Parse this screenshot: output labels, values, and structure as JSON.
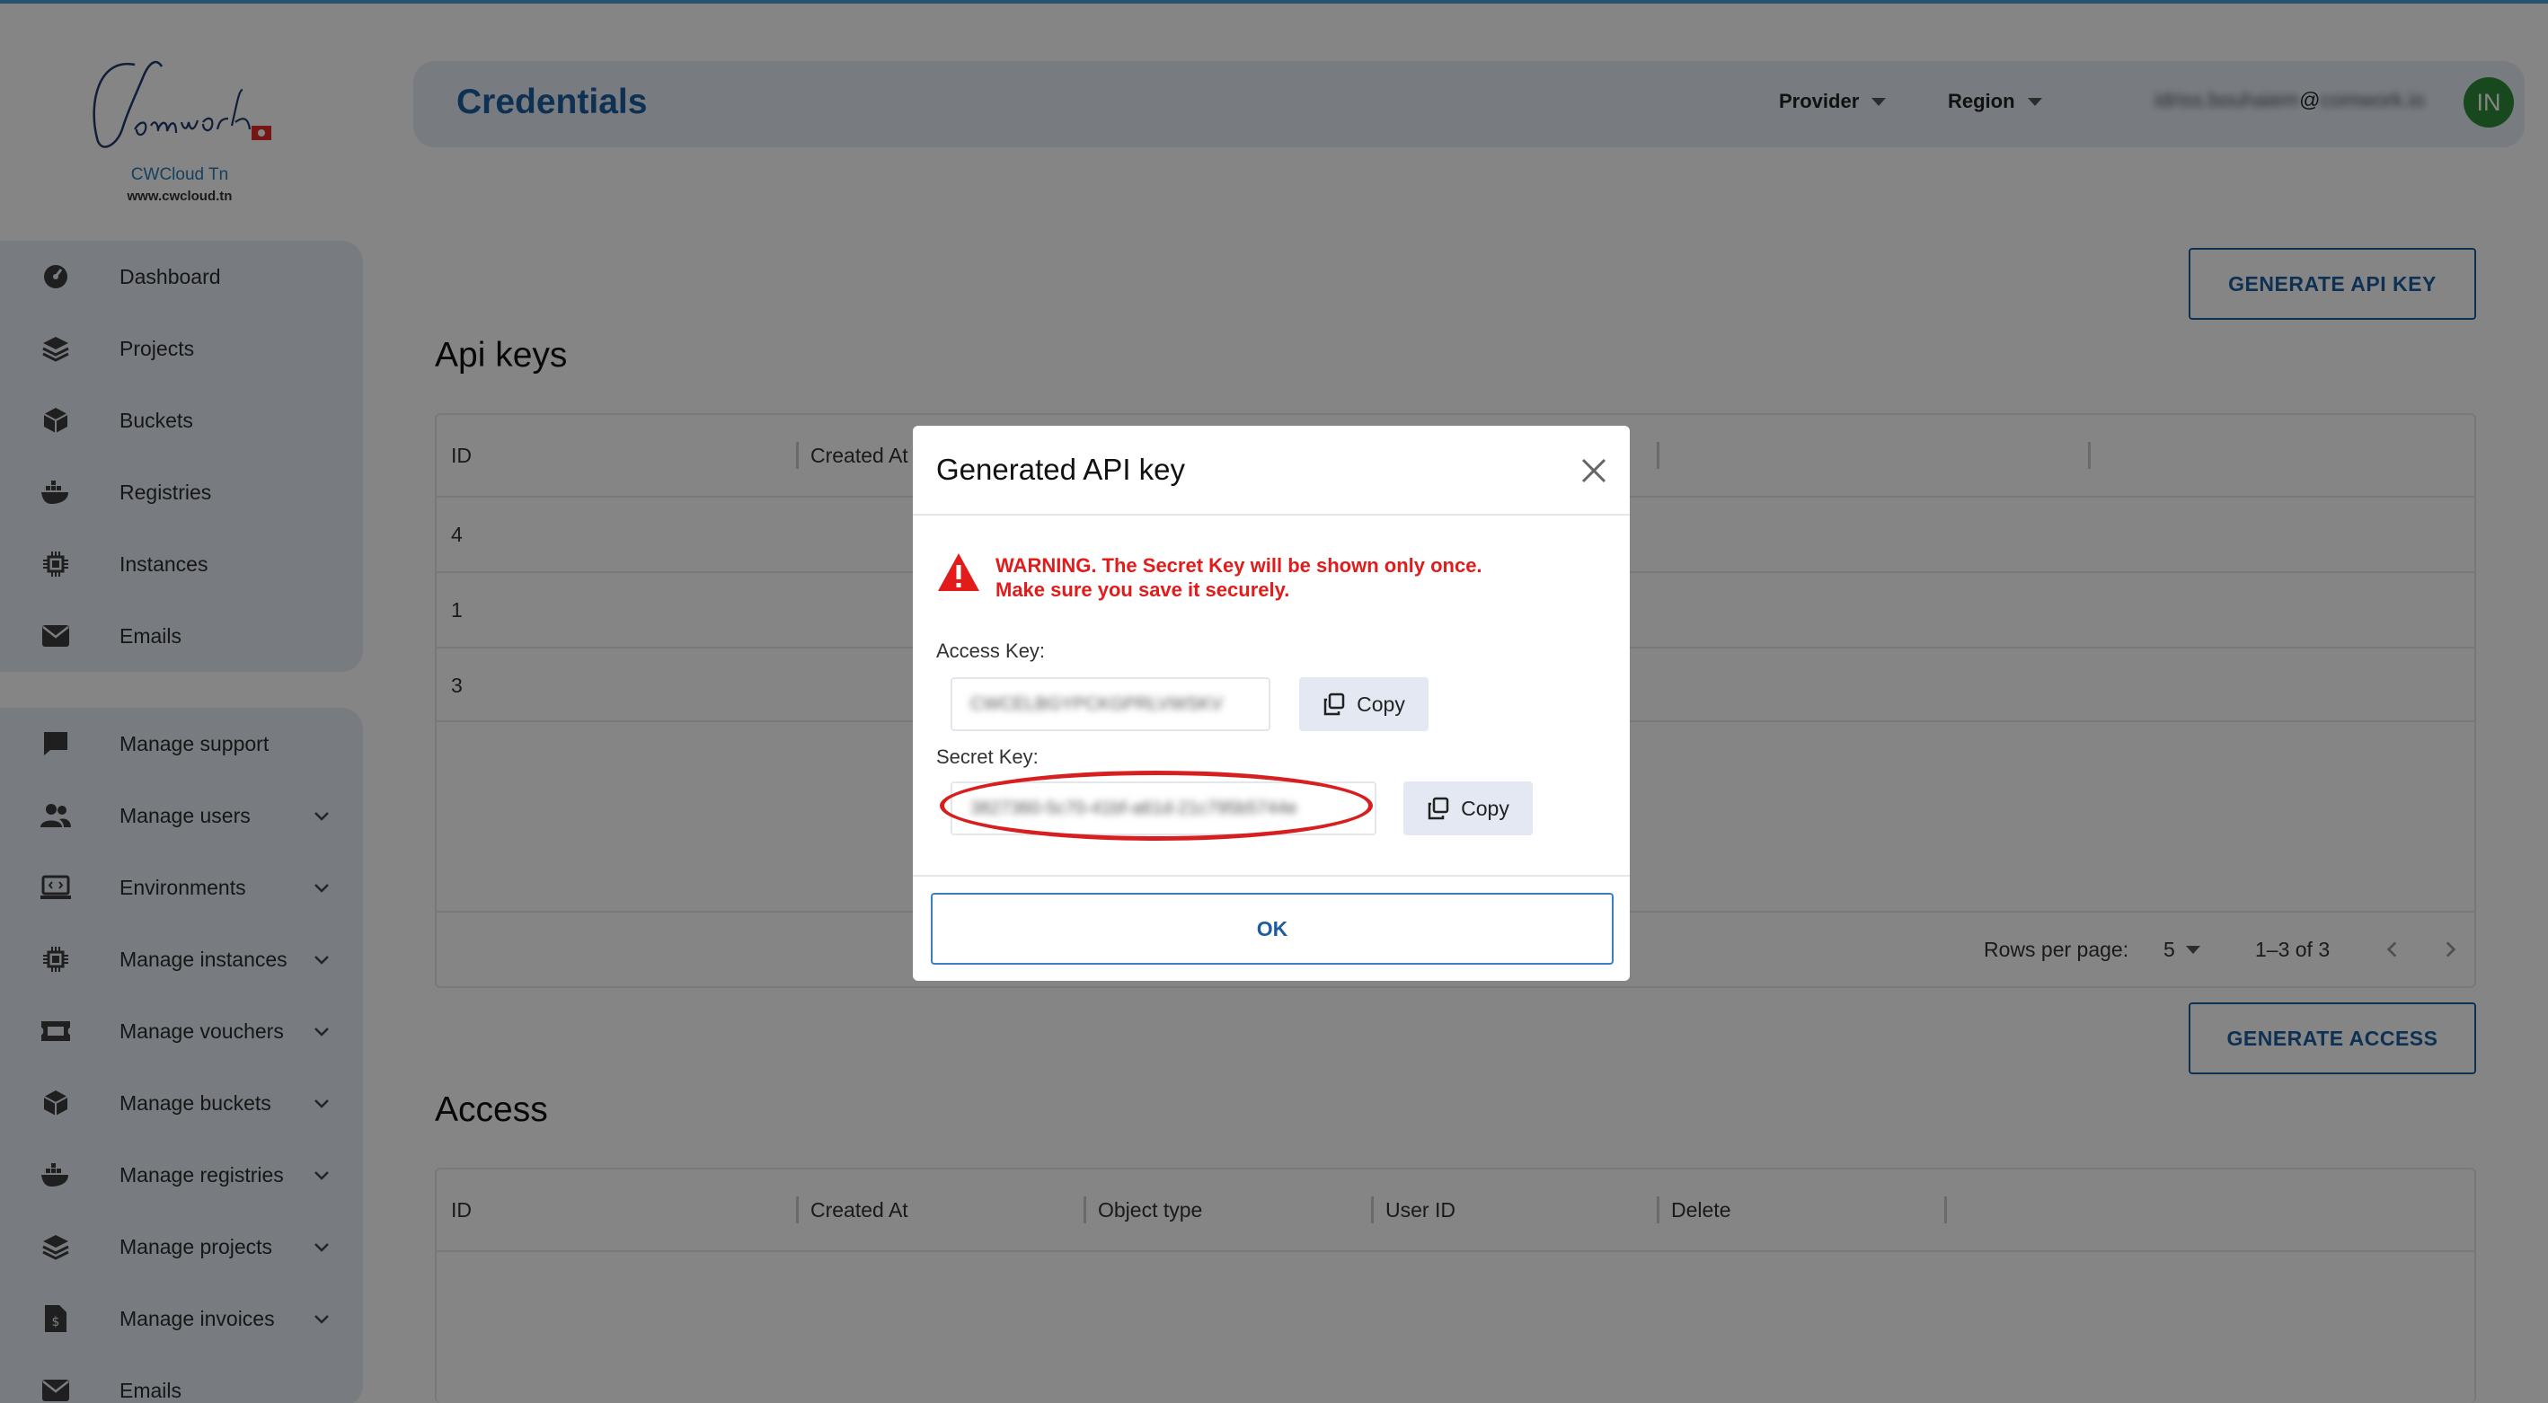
{
  "brand": {
    "name": "CWCloud Tn",
    "url": "www.cwcloud.tn",
    "logo_text": "Comwork"
  },
  "sidebar": {
    "group1": [
      {
        "label": "Dashboard",
        "icon": "dashboard-icon"
      },
      {
        "label": "Projects",
        "icon": "layers-icon"
      },
      {
        "label": "Buckets",
        "icon": "cube-icon"
      },
      {
        "label": "Registries",
        "icon": "docker-icon"
      },
      {
        "label": "Instances",
        "icon": "chip-icon"
      },
      {
        "label": "Emails",
        "icon": "envelope-icon"
      }
    ],
    "group2": [
      {
        "label": "Manage support",
        "icon": "chat-icon"
      },
      {
        "label": "Manage users",
        "icon": "users-icon"
      },
      {
        "label": "Environments",
        "icon": "laptop-code-icon"
      },
      {
        "label": "Manage instances",
        "icon": "chip-icon"
      },
      {
        "label": "Manage vouchers",
        "icon": "ticket-icon"
      },
      {
        "label": "Manage buckets",
        "icon": "cube-icon"
      },
      {
        "label": "Manage registries",
        "icon": "docker-icon"
      },
      {
        "label": "Manage projects",
        "icon": "layers-icon"
      },
      {
        "label": "Manage invoices",
        "icon": "invoice-icon"
      },
      {
        "label": "Emails",
        "icon": "envelope-icon"
      }
    ]
  },
  "header": {
    "title": "Credentials",
    "provider_label": "Provider",
    "region_label": "Region",
    "email_masked": "idriss.bouhaiem",
    "email_at": "@",
    "email_domain_masked": "comwork.io",
    "avatar_initials": "IN",
    "avatar_color": "#2e8b3a"
  },
  "apikeys": {
    "generate_button": "GENERATE API KEY",
    "section_title": "Api keys",
    "columns": [
      "ID",
      "Created At"
    ],
    "rows": [
      {
        "id": "4"
      },
      {
        "id": "1"
      },
      {
        "id": "3"
      }
    ],
    "rows_per_page_label": "Rows per page:",
    "rows_per_page_value": "5",
    "range_text": "1–3 of 3"
  },
  "access": {
    "generate_button": "GENERATE ACCESS",
    "section_title": "Access",
    "columns": [
      "ID",
      "Created At",
      "Object type",
      "User ID",
      "Delete"
    ]
  },
  "modal": {
    "title": "Generated API key",
    "warning_line1": "WARNING. The Secret Key will be shown only once.",
    "warning_line2": "Make sure you save it securely.",
    "access_key_label": "Access Key:",
    "access_key_value": "CWCELBGYPCKGPRLVWSKV",
    "secret_key_label": "Secret Key:",
    "secret_key_value": "3827360-5c70-41bf-a61d-21c795b5744e",
    "copy_label": "Copy",
    "ok_label": "OK",
    "warning_color": "#e21b1b",
    "annotation_color": "#d81f1f"
  }
}
